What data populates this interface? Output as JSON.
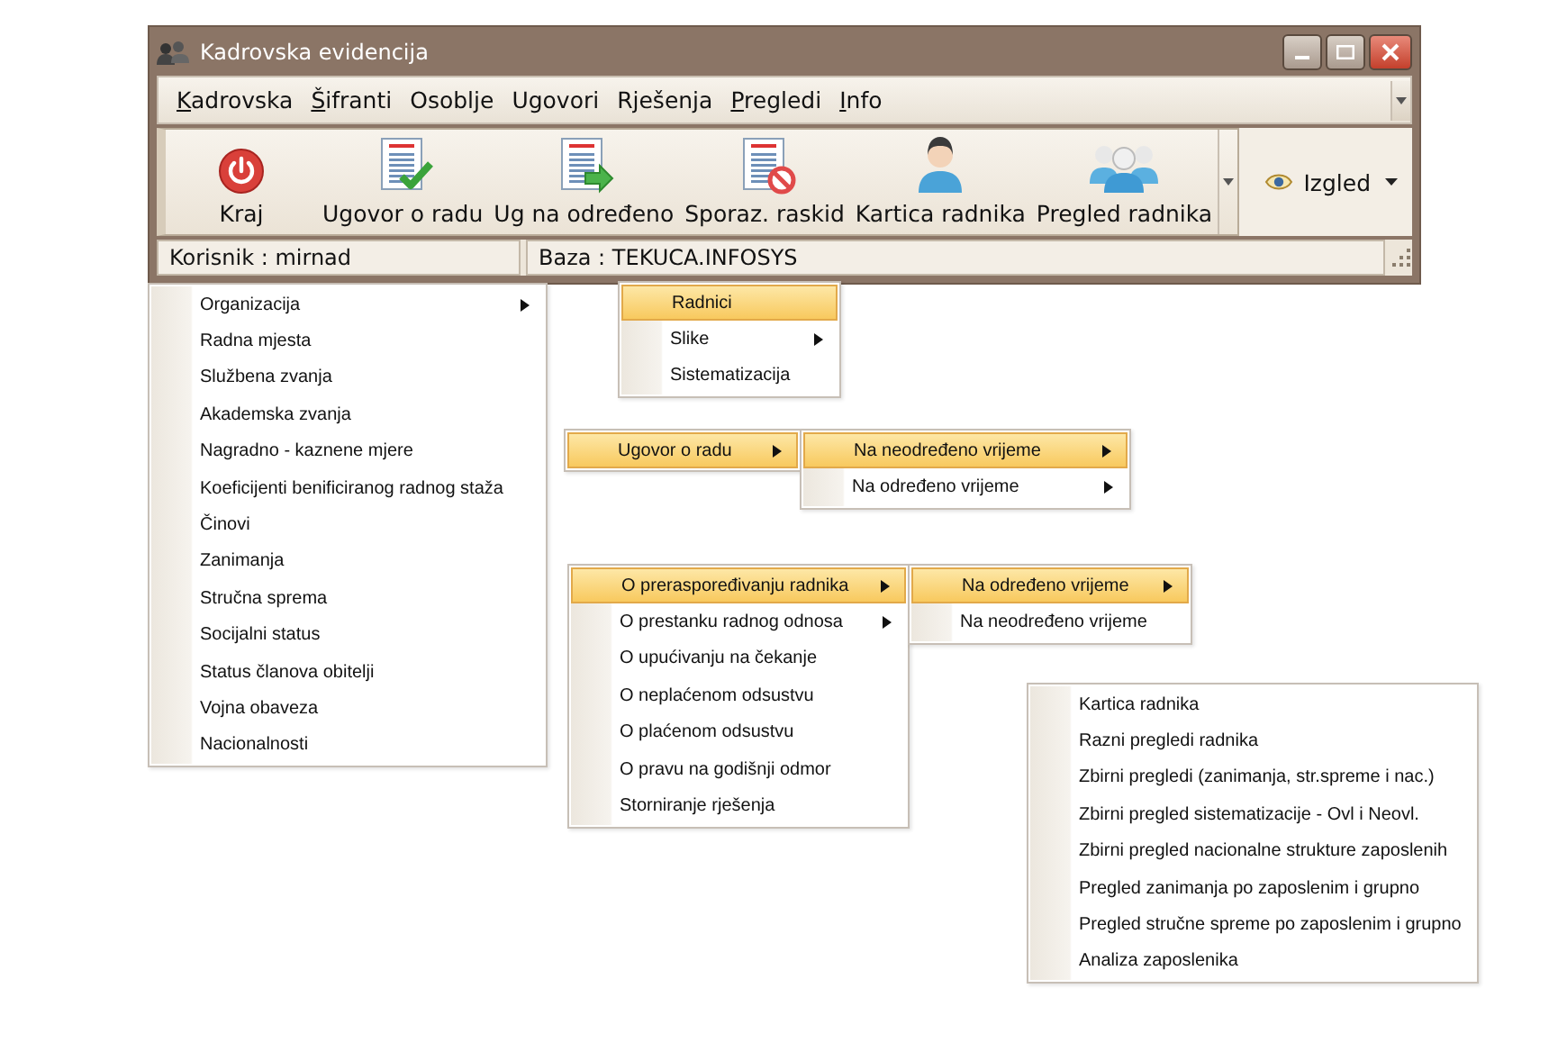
{
  "window": {
    "title": "Kadrovska evidencija"
  },
  "menu_bar": {
    "items": [
      {
        "label": "Kadrovska",
        "underlined": true
      },
      {
        "label": "Šifranti",
        "underlined": true
      },
      {
        "label": "Osoblje",
        "underlined": false
      },
      {
        "label": "Ugovori",
        "underlined": false
      },
      {
        "label": "Rješenja",
        "underlined": false
      },
      {
        "label": "Pregledi",
        "underlined": true
      },
      {
        "label": "Info",
        "underlined": true
      }
    ]
  },
  "toolbar": {
    "buttons": [
      {
        "label": "Kraj",
        "kind": "power"
      },
      {
        "label": "Ugovor o radu",
        "kind": "doc-check"
      },
      {
        "label": "Ug na određeno",
        "kind": "doc-arrow"
      },
      {
        "label": "Sporaz. raskid",
        "kind": "doc-cancel"
      },
      {
        "label": "Kartica radnika",
        "kind": "person"
      },
      {
        "label": "Pregled radnika",
        "kind": "people"
      }
    ],
    "view_button": {
      "label": "Izgled"
    }
  },
  "status_bar": {
    "user": "Korisnik : mirnad",
    "database": "Baza : TEKUCA.INFOSYS"
  },
  "menus": [
    {
      "panels": [
        {
          "items": [
            {
              "label": "Organizacija",
              "submenu": true,
              "selected": false
            },
            {
              "label": "Radna mjesta",
              "submenu": false,
              "selected": false
            },
            {
              "label": "Službena zvanja",
              "submenu": false,
              "selected": false
            },
            {
              "label": "Akademska zvanja",
              "submenu": false,
              "selected": false
            },
            {
              "label": "Nagradno - kaznene mjere",
              "submenu": false,
              "selected": false
            },
            {
              "label": "Koeficijenti benificiranog radnog staža",
              "submenu": false,
              "selected": false
            },
            {
              "label": "Činovi",
              "submenu": false,
              "selected": false
            },
            {
              "label": "Zanimanja",
              "submenu": false,
              "selected": false
            },
            {
              "label": "Stručna sprema",
              "submenu": false,
              "selected": false
            },
            {
              "label": "Socijalni status",
              "submenu": false,
              "selected": false
            },
            {
              "label": "Status članova obitelji",
              "submenu": false,
              "selected": false
            },
            {
              "label": "Vojna obaveza",
              "submenu": false,
              "selected": false
            },
            {
              "label": "Nacionalnosti",
              "submenu": false,
              "selected": false
            }
          ]
        }
      ]
    },
    {
      "panels": [
        {
          "items": [
            {
              "label": "Radnici",
              "submenu": false,
              "selected": true
            },
            {
              "label": "Slike",
              "submenu": true,
              "selected": false
            },
            {
              "label": "Sistematizacija",
              "submenu": false,
              "selected": false
            }
          ]
        }
      ]
    },
    {
      "panels": [
        {
          "items": [
            {
              "label": "Ugovor o radu",
              "submenu": true,
              "selected": true
            }
          ]
        },
        {
          "items": [
            {
              "label": "Na neodređeno vrijeme",
              "submenu": true,
              "selected": true
            },
            {
              "label": "Na određeno vrijeme",
              "submenu": true,
              "selected": false
            }
          ]
        }
      ]
    },
    {
      "panels": [
        {
          "items": [
            {
              "label": "O preraspoređivanju radnika",
              "submenu": true,
              "selected": true
            },
            {
              "label": "O prestanku radnog odnosa",
              "submenu": true,
              "selected": false
            },
            {
              "label": "O upućivanju na čekanje",
              "submenu": false,
              "selected": false
            },
            {
              "label": "O neplaćenom odsustvu",
              "submenu": false,
              "selected": false
            },
            {
              "label": "O plaćenom odsustvu",
              "submenu": false,
              "selected": false
            },
            {
              "label": "O pravu na godišnji odmor",
              "submenu": false,
              "selected": false
            },
            {
              "label": "Storniranje rješenja",
              "submenu": false,
              "selected": false
            }
          ]
        },
        {
          "items": [
            {
              "label": "Na određeno vrijeme",
              "submenu": true,
              "selected": true
            },
            {
              "label": "Na neodređeno vrijeme",
              "submenu": false,
              "selected": false
            }
          ]
        }
      ]
    },
    {
      "panels": [
        {
          "items": [
            {
              "label": "Kartica radnika",
              "submenu": false,
              "selected": false
            },
            {
              "label": "Razni pregledi radnika",
              "submenu": false,
              "selected": false
            },
            {
              "label": "Zbirni pregledi (zanimanja, str.spreme i nac.)",
              "submenu": false,
              "selected": false
            },
            {
              "label": "Zbirni pregled sistematizacije - Ovl i Neovl.",
              "submenu": false,
              "selected": false
            },
            {
              "label": "Zbirni pregled nacionalne strukture zaposlenih",
              "submenu": false,
              "selected": false
            },
            {
              "label": "Pregled zanimanja po zaposlenim i grupno",
              "submenu": false,
              "selected": false
            },
            {
              "label": "Pregled stručne spreme po zaposlenim i grupno",
              "submenu": false,
              "selected": false
            },
            {
              "label": "Analiza zaposlenika",
              "submenu": false,
              "selected": false
            }
          ]
        }
      ]
    }
  ]
}
